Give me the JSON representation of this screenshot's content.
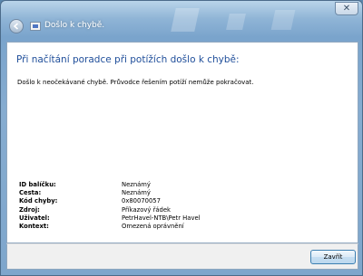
{
  "window": {
    "title": "Došlo k chybě.",
    "close_glyph": "✕",
    "back_glyph": "◀"
  },
  "main": {
    "heading": "Při načítání poradce při potížích došlo k chybě:",
    "message": "Došlo k neočekávané chybě. Průvodce řešením potíží nemůže pokračovat."
  },
  "details": [
    {
      "label": "ID balíčku:",
      "value": "Neznámý"
    },
    {
      "label": "Cesta:",
      "value": "Neznámý"
    },
    {
      "label": "Kód chyby:",
      "value": "0x80070057"
    },
    {
      "label": "Zdroj:",
      "value": "Příkazový řádek"
    },
    {
      "label": "Uživatel:",
      "value": "PetrHavel-NTB\\Petr Havel"
    },
    {
      "label": "Kontext:",
      "value": "Omezená oprávnění"
    }
  ],
  "footer": {
    "close_button_label": "Zavřít"
  },
  "colors": {
    "heading": "#1f4e9a",
    "frame": "#7aa4cc"
  }
}
